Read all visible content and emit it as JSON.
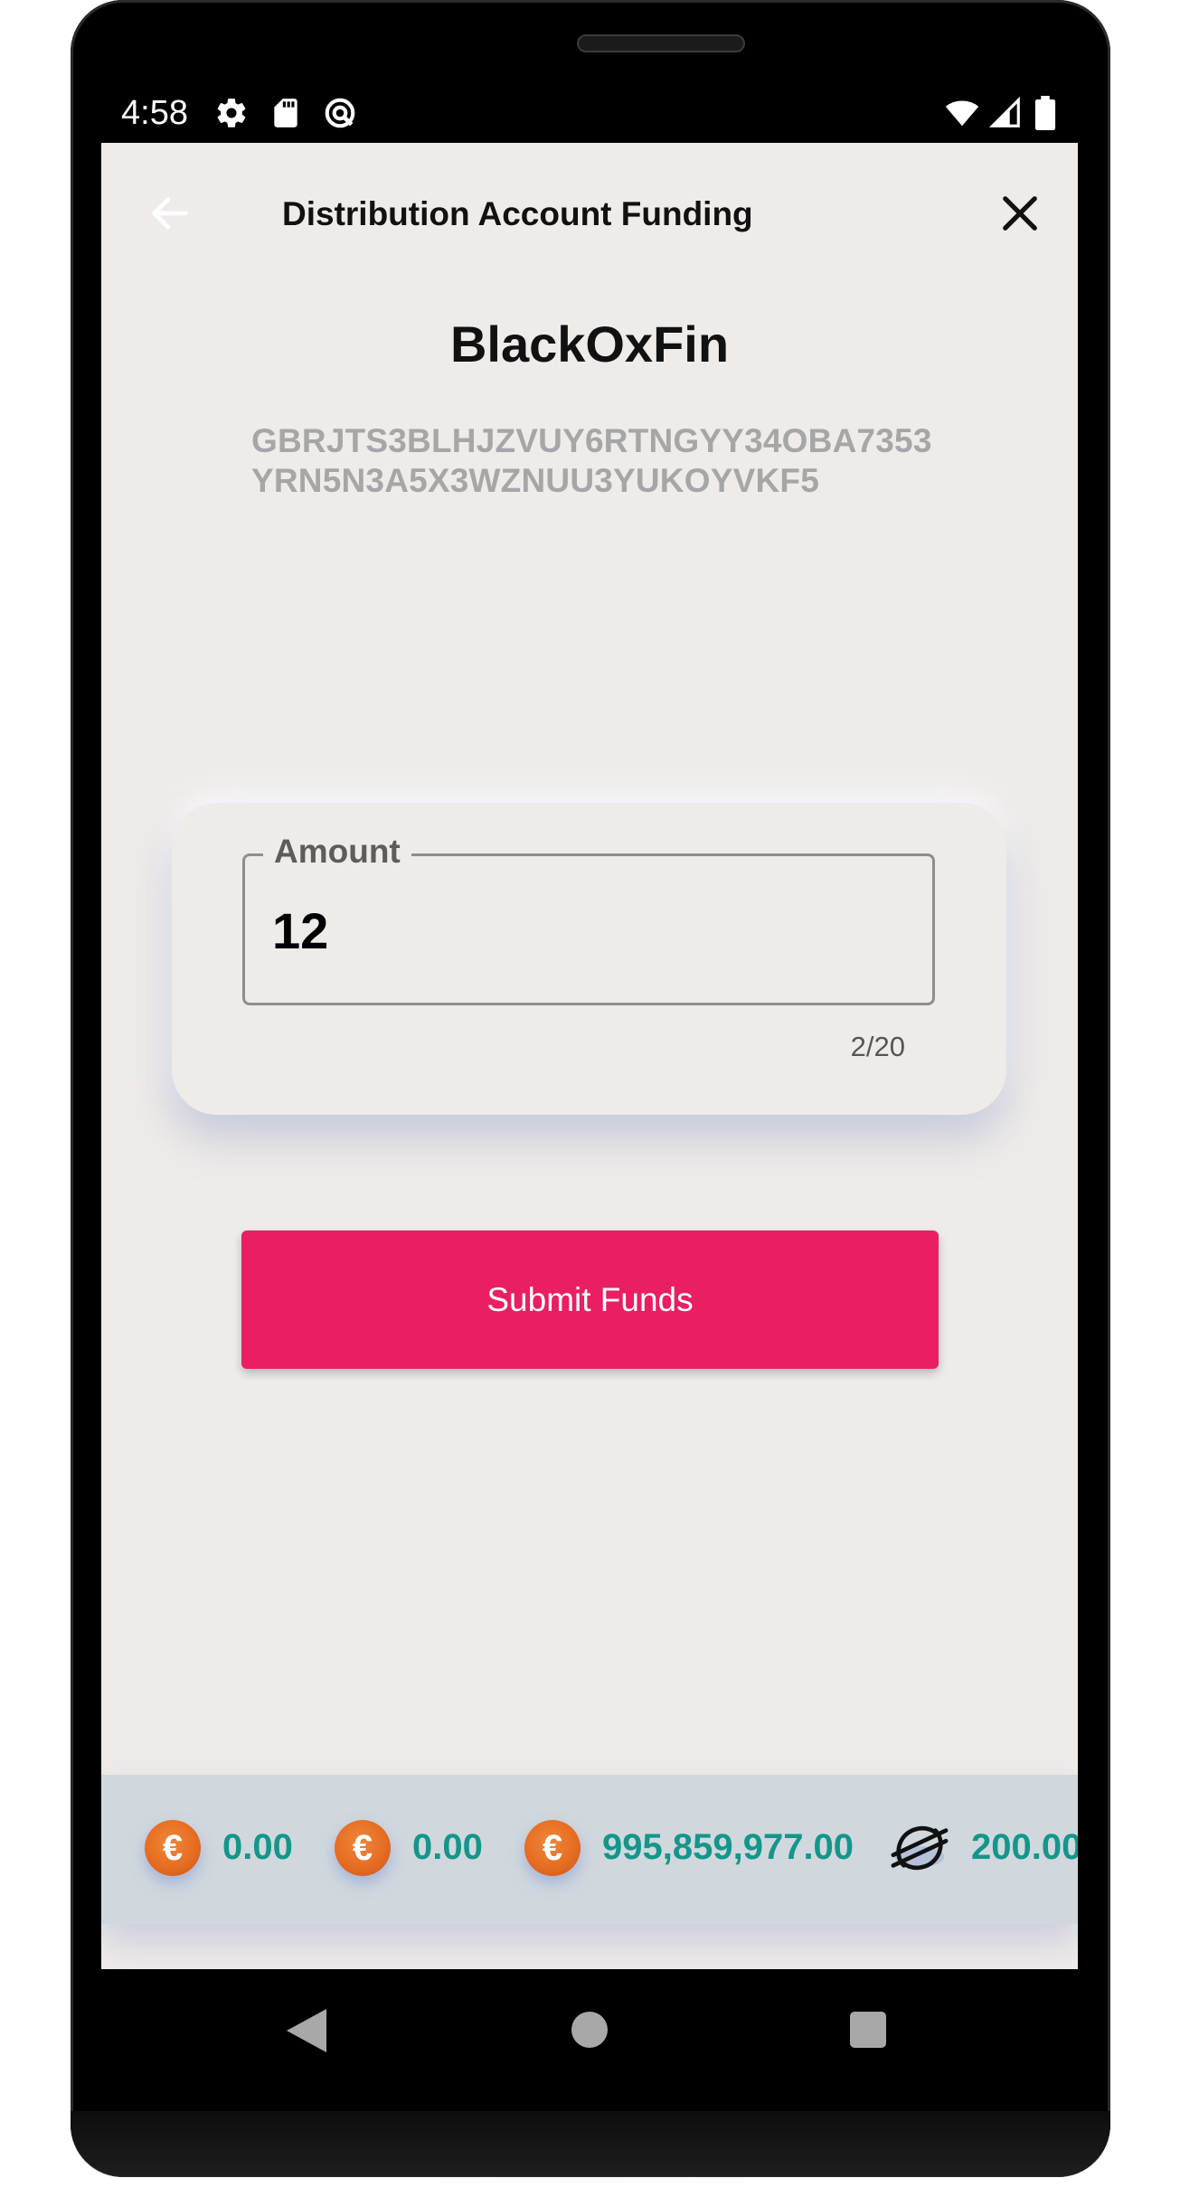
{
  "status_bar": {
    "time": "4:58",
    "left_icons": [
      "settings-icon",
      "sd-card-icon",
      "vpn-icon"
    ],
    "right_icons": [
      "wifi-icon",
      "signal-icon",
      "battery-icon"
    ]
  },
  "app_bar": {
    "title": "Distribution Account Funding",
    "back_icon": "arrow-left-icon",
    "close_icon": "close-icon"
  },
  "account": {
    "name": "BlackOxFin",
    "key_line1": "GBRJTS3BLHJZVUY6RTNGYY34OBA7353",
    "key_line2": "YRN5N3A5X3WZNUU3YUKOYVKF5"
  },
  "amount_field": {
    "label": "Amount",
    "value": "12",
    "counter": "2/20"
  },
  "submit_button": {
    "label": "Submit Funds",
    "color": "#ea1e63"
  },
  "balances": [
    {
      "icon": "euro-coin-icon",
      "symbol": "€",
      "amount": "0.00"
    },
    {
      "icon": "euro-coin-icon",
      "symbol": "€",
      "amount": "0.00"
    },
    {
      "icon": "euro-coin-icon",
      "symbol": "€",
      "amount": "995,859,977.00"
    },
    {
      "icon": "stellar-icon",
      "symbol": "",
      "amount": "200.00"
    }
  ],
  "nav_bar": {
    "icons": [
      "nav-back-icon",
      "nav-home-icon",
      "nav-recents-icon"
    ]
  },
  "colors": {
    "screen_background": "#efebe9",
    "balance_text": "#14968a",
    "balance_strip": "#d0d8de",
    "euro_coin": "#e66d22"
  }
}
